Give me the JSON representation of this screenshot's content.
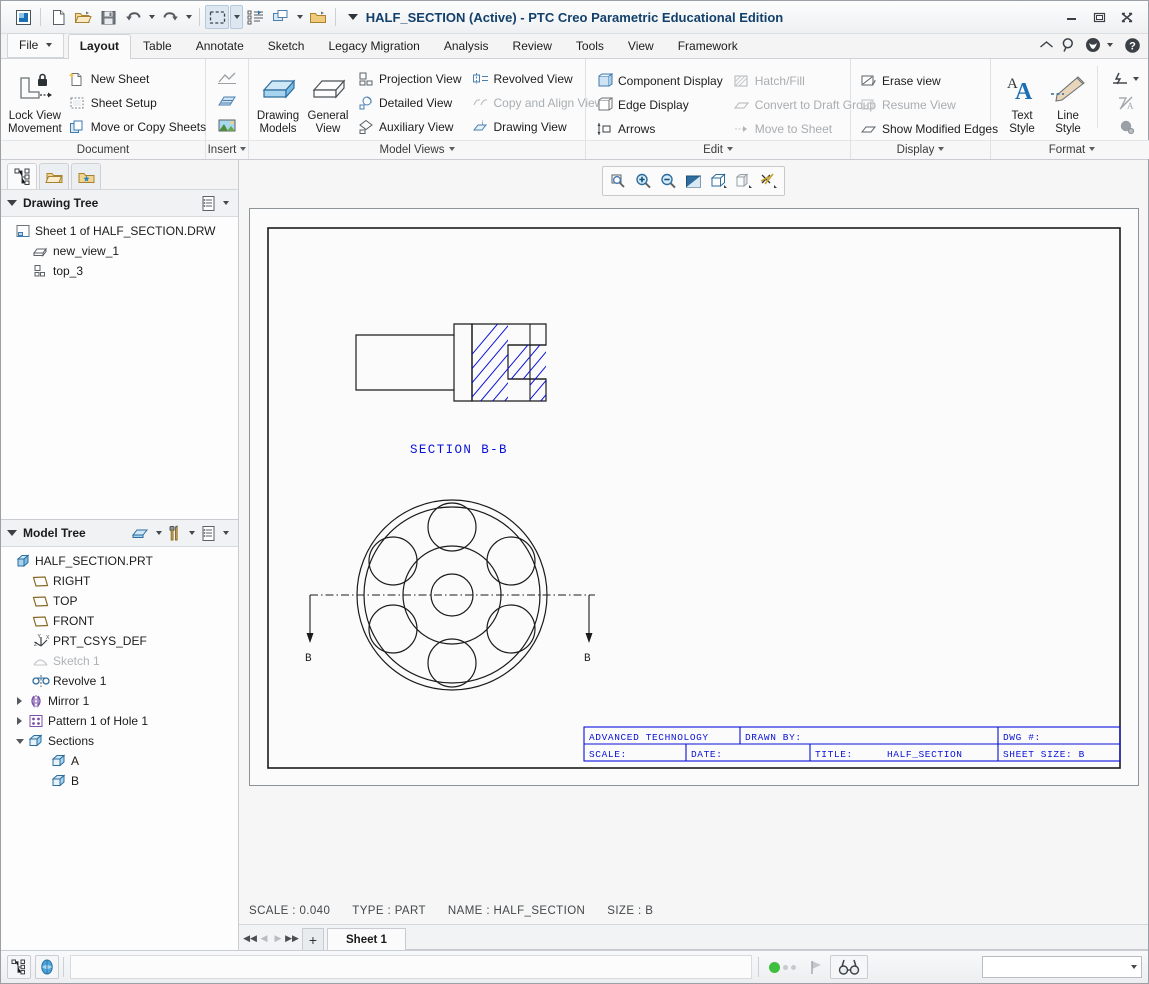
{
  "window": {
    "title": "HALF_SECTION (Active) - PTC Creo Parametric Educational Edition",
    "minimize_label": "Minimize",
    "maximize_label": "Maximize",
    "close_label": "Close"
  },
  "quick_access": [
    {
      "name": "creo-app-icon",
      "label": "Creo"
    },
    {
      "name": "new-icon",
      "label": "New"
    },
    {
      "name": "open-icon",
      "label": "Open"
    },
    {
      "name": "save-icon",
      "label": "Save"
    },
    {
      "name": "undo-icon",
      "label": "Undo"
    },
    {
      "name": "redo-icon",
      "label": "Redo"
    },
    {
      "name": "select-icon",
      "label": "Select Items"
    },
    {
      "name": "regenerate-icon",
      "label": "Regenerate"
    },
    {
      "name": "window-icon",
      "label": "Window"
    },
    {
      "name": "close-window-icon",
      "label": "Close"
    },
    {
      "name": "customize-icon",
      "label": "Customize Quick Access Toolbar"
    }
  ],
  "ribbon": {
    "tabs": [
      {
        "label": "File",
        "active": false,
        "has_arrow": true
      },
      {
        "label": "Layout",
        "active": true
      },
      {
        "label": "Table",
        "active": false
      },
      {
        "label": "Annotate",
        "active": false
      },
      {
        "label": "Sketch",
        "active": false
      },
      {
        "label": "Legacy Migration",
        "active": false
      },
      {
        "label": "Analysis",
        "active": false
      },
      {
        "label": "Review",
        "active": false
      },
      {
        "label": "Tools",
        "active": false
      },
      {
        "label": "View",
        "active": false
      },
      {
        "label": "Framework",
        "active": false
      }
    ],
    "header_icons": [
      {
        "name": "collapse-ribbon-icon"
      },
      {
        "name": "search-icon"
      },
      {
        "name": "creo-globe-icon"
      },
      {
        "name": "help-icon"
      }
    ],
    "groups": {
      "document": {
        "label": "Document",
        "lock_view": "Lock View\nMovement",
        "lock_view_line1": "Lock View",
        "lock_view_line2": "Movement",
        "items": [
          {
            "label": "New Sheet",
            "icon": "new-sheet-icon",
            "disabled": false
          },
          {
            "label": "Sheet Setup",
            "icon": "sheet-setup-icon",
            "disabled": false
          },
          {
            "label": "Move or Copy Sheets",
            "icon": "move-copy-sheets-icon",
            "disabled": false
          }
        ]
      },
      "insert": {
        "label": "Insert",
        "items": [
          {
            "name": "insert-curve-icon"
          },
          {
            "name": "insert-table-icon"
          },
          {
            "name": "insert-image-icon"
          }
        ]
      },
      "model_views": {
        "label": "Model Views",
        "drawing_models_line1": "Drawing",
        "drawing_models_line2": "Models",
        "general_view_line1": "General",
        "general_view_line2": "View",
        "col1": [
          {
            "label": "Projection View",
            "icon": "projection-view-icon",
            "disabled": false
          },
          {
            "label": "Detailed View",
            "icon": "detailed-view-icon",
            "disabled": false
          },
          {
            "label": "Auxiliary View",
            "icon": "auxiliary-view-icon",
            "disabled": false
          }
        ],
        "col2": [
          {
            "label": "Revolved View",
            "icon": "revolved-view-icon",
            "disabled": false
          },
          {
            "label": "Copy and Align View",
            "icon": "copy-align-view-icon",
            "disabled": true
          },
          {
            "label": "Drawing View",
            "icon": "drawing-view-icon",
            "disabled": false
          }
        ]
      },
      "edit": {
        "label": "Edit",
        "col1": [
          {
            "label": "Component Display",
            "icon": "component-display-icon",
            "disabled": false
          },
          {
            "label": "Edge Display",
            "icon": "edge-display-icon",
            "disabled": false
          },
          {
            "label": "Arrows",
            "icon": "arrows-icon",
            "disabled": false
          }
        ],
        "col2": [
          {
            "label": "Hatch/Fill",
            "icon": "hatch-fill-icon",
            "disabled": true
          },
          {
            "label": "Convert to Draft Group",
            "icon": "convert-draft-group-icon",
            "disabled": true
          },
          {
            "label": "Move to Sheet",
            "icon": "move-to-sheet-icon",
            "disabled": true
          }
        ]
      },
      "display": {
        "label": "Display",
        "items": [
          {
            "label": "Erase view",
            "icon": "erase-view-icon",
            "disabled": false
          },
          {
            "label": "Resume View",
            "icon": "resume-view-icon",
            "disabled": true
          },
          {
            "label": "Show Modified Edges",
            "icon": "show-modified-edges-icon",
            "disabled": false
          }
        ]
      },
      "format": {
        "label": "Format",
        "text_style_line1": "Text",
        "text_style_line2": "Style",
        "line_style_line1": "Line",
        "line_style_line2": "Style",
        "extras": [
          {
            "name": "line-thickness-icon"
          },
          {
            "name": "clear-format-icon"
          },
          {
            "name": "text-orientation-icon"
          }
        ]
      }
    }
  },
  "left_panel": {
    "nav_tabs": [
      {
        "name": "model-tree-tab",
        "active": true
      },
      {
        "name": "folder-browser-tab",
        "active": false
      },
      {
        "name": "favorites-tab",
        "active": false
      }
    ],
    "drawing_tree": {
      "title": "Drawing Tree",
      "items": [
        {
          "label": "Sheet 1 of HALF_SECTION.DRW",
          "icon": "sheet-icon",
          "indent": 0,
          "expander": "none",
          "dim": false
        },
        {
          "label": "new_view_1",
          "icon": "general-view-icon",
          "indent": 1,
          "expander": "none",
          "dim": false
        },
        {
          "label": "top_3",
          "icon": "projection-view-icon",
          "indent": 1,
          "expander": "none",
          "dim": false
        }
      ]
    },
    "model_tree": {
      "title": "Model Tree",
      "items": [
        {
          "label": "HALF_SECTION.PRT",
          "icon": "part-icon",
          "indent": 0,
          "expander": "none",
          "dim": false
        },
        {
          "label": "RIGHT",
          "icon": "datum-plane-icon",
          "indent": 1,
          "expander": "none",
          "dim": false
        },
        {
          "label": "TOP",
          "icon": "datum-plane-icon",
          "indent": 1,
          "expander": "none",
          "dim": false
        },
        {
          "label": "FRONT",
          "icon": "datum-plane-icon",
          "indent": 1,
          "expander": "none",
          "dim": false
        },
        {
          "label": "PRT_CSYS_DEF",
          "icon": "csys-icon",
          "indent": 1,
          "expander": "none",
          "dim": false
        },
        {
          "label": "Sketch 1",
          "icon": "sketch-icon",
          "indent": 1,
          "expander": "none",
          "dim": true
        },
        {
          "label": "Revolve 1",
          "icon": "revolve-icon",
          "indent": 1,
          "expander": "none",
          "dim": false
        },
        {
          "label": "Mirror 1",
          "icon": "mirror-icon",
          "indent": 1,
          "expander": "collapsed",
          "dim": false
        },
        {
          "label": "Pattern 1 of Hole 1",
          "icon": "pattern-icon",
          "indent": 1,
          "expander": "collapsed",
          "dim": false
        },
        {
          "label": "Sections",
          "icon": "sections-icon",
          "indent": 1,
          "expander": "expanded",
          "dim": false
        },
        {
          "label": "A",
          "icon": "section-icon",
          "indent": 2,
          "expander": "none",
          "dim": false
        },
        {
          "label": "B",
          "icon": "section-icon",
          "indent": 2,
          "expander": "none",
          "dim": false
        }
      ]
    }
  },
  "graphics_toolbar": [
    {
      "name": "refit-icon",
      "label": "Refit"
    },
    {
      "name": "zoom-in-icon",
      "label": "Zoom In"
    },
    {
      "name": "zoom-out-icon",
      "label": "Zoom Out"
    },
    {
      "name": "repaint-icon",
      "label": "Repaint"
    },
    {
      "name": "display-style-icon",
      "label": "Display Style"
    },
    {
      "name": "saved-orientations-icon",
      "label": "Saved Orientations"
    },
    {
      "name": "datum-display-icon",
      "label": "Datum Display Filters"
    }
  ],
  "drawing": {
    "section_label": "SECTION  B-B",
    "section_marker_left": "B",
    "section_marker_right": "B",
    "accent_color": "#0a12d8",
    "title_block": {
      "company": "ADVANCED TECHNOLOGY",
      "drawn_by": "DRAWN BY:",
      "dwg_no": "DWG #:",
      "scale": "SCALE:",
      "date": "DATE:",
      "title_label": "TITLE:",
      "title_value": "HALF_SECTION",
      "sheet_size": "SHEET SIZE: B"
    }
  },
  "status": {
    "scale": "SCALE : 0.040",
    "type": "TYPE : PART",
    "name": "NAME : HALF_SECTION",
    "size": "SIZE : B",
    "sheet_tab": "Sheet 1",
    "add_sheet": "+",
    "nav_first": "◀◀",
    "nav_prev": "◀",
    "nav_next": "▶",
    "nav_last": "▶▶"
  },
  "bottom_bar": {
    "left_icons": [
      {
        "name": "model-tree-toggle-icon"
      },
      {
        "name": "browser-toggle-icon"
      }
    ],
    "right_icons": [
      {
        "name": "status-indicator-icon"
      },
      {
        "name": "flag-icon"
      },
      {
        "name": "search-filter-icon"
      }
    ],
    "selection_dropdown_value": ""
  }
}
